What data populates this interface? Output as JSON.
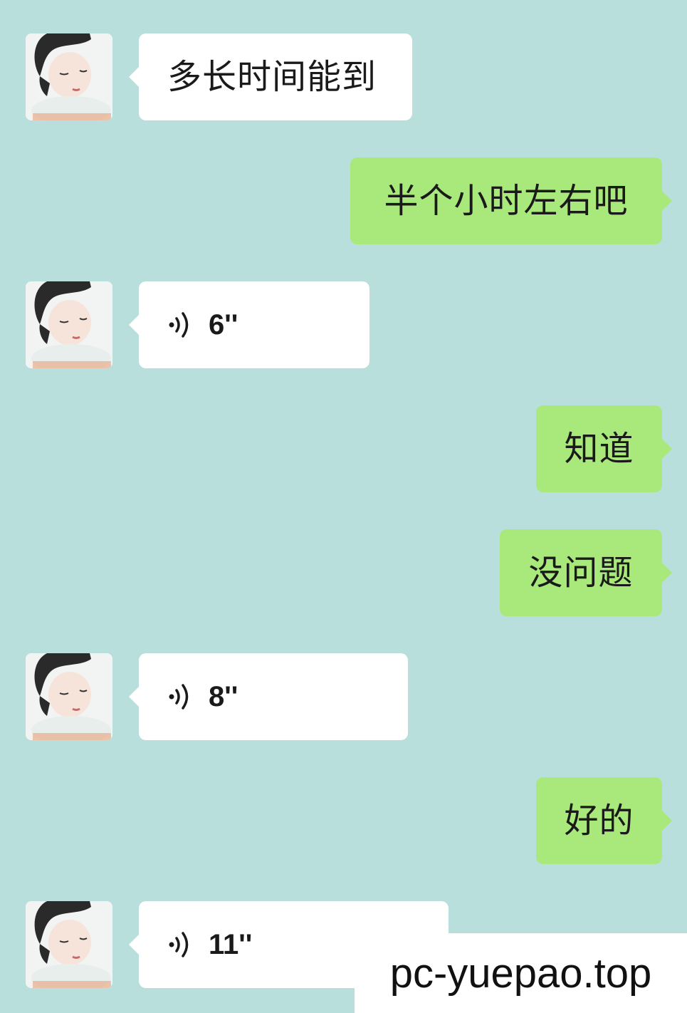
{
  "messages": [
    {
      "side": "recv",
      "kind": "text",
      "text": "多长时间能到"
    },
    {
      "side": "sent",
      "kind": "text",
      "text": "半个小时左右吧"
    },
    {
      "side": "recv",
      "kind": "voice",
      "duration": "6''"
    },
    {
      "side": "sent",
      "kind": "text",
      "text": "知道"
    },
    {
      "side": "sent",
      "kind": "text",
      "text": "没问题"
    },
    {
      "side": "recv",
      "kind": "voice",
      "duration": "8''"
    },
    {
      "side": "sent",
      "kind": "text",
      "text": "好的"
    },
    {
      "side": "recv",
      "kind": "voice",
      "duration": "11''"
    }
  ],
  "watermark": "pc-yuepao.top",
  "icons": {
    "avatar": "avatar-girl-icon",
    "voice": "voice-wave-icon"
  },
  "colors": {
    "background": "#b8dfdc",
    "sent_bubble": "#a9e97c",
    "received_bubble": "#ffffff"
  }
}
